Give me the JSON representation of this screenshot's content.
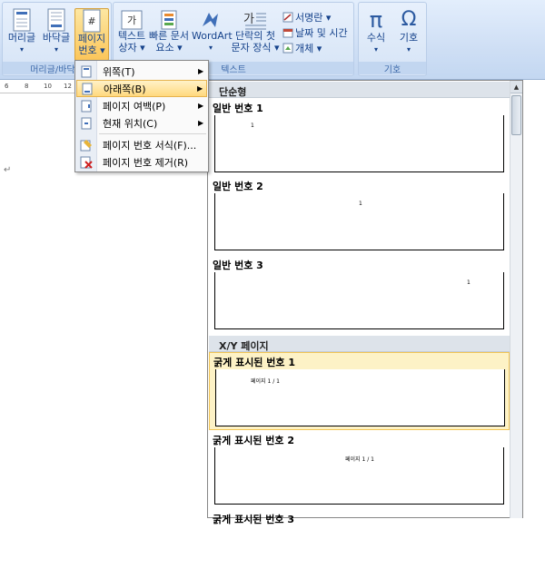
{
  "ribbon": {
    "groups": {
      "header_footer": "머리글/바닥글",
      "text": "텍스트",
      "symbols": "기호"
    },
    "header_btn": [
      "머리글",
      "▾"
    ],
    "footer_btn": [
      "바닥글",
      "▾"
    ],
    "pagenum_btn": [
      "페이지",
      "번호 ▾"
    ],
    "textbox_btn": [
      "텍스트",
      "상자 ▾"
    ],
    "quickparts_btn": [
      "빠른 문서",
      "요소 ▾"
    ],
    "wordart_btn": [
      "WordArt",
      "▾"
    ],
    "dropcap_btn": [
      "단락의 첫",
      "문자 장식 ▾"
    ],
    "signature": "서명란 ▾",
    "datetime": "날짜 및 시간",
    "object": "개체 ▾",
    "equation_btn": [
      "수식",
      "▾"
    ],
    "symbol_btn": [
      "기호",
      "▾"
    ]
  },
  "ruler": {
    "ticks": [
      "6",
      "8",
      "10",
      "12"
    ]
  },
  "doc": {
    "para_mark": "↵"
  },
  "menu": {
    "items": [
      {
        "label": "위쪽(T)",
        "arrow": "▶"
      },
      {
        "label": "아래쪽(B)",
        "arrow": "▶"
      },
      {
        "label": "페이지 여백(P)",
        "arrow": "▶"
      },
      {
        "label": "현재 위치(C)",
        "arrow": "▶"
      },
      {
        "label": "페이지 번호 서식(F)..."
      },
      {
        "label": "페이지 번호 제거(R)"
      }
    ]
  },
  "gallery": {
    "sections": [
      "단순형",
      "X/Y 페이지"
    ],
    "items": [
      {
        "title": "일반 번호 1",
        "preview": "1"
      },
      {
        "title": "일반 번호 2",
        "preview": "1"
      },
      {
        "title": "일반 번호 3",
        "preview": "1"
      },
      {
        "title": "굵게 표시된 번호 1",
        "preview": "페이지 1 / 1"
      },
      {
        "title": "굵게 표시된 번호 2",
        "preview": "페이지 1 / 1"
      },
      {
        "title": "굵게 표시된 번호 3"
      }
    ]
  },
  "colors": {
    "accent": "#fbc65b",
    "ribbon": "#cfdff5",
    "menu_highlight": "#ffd97e"
  }
}
